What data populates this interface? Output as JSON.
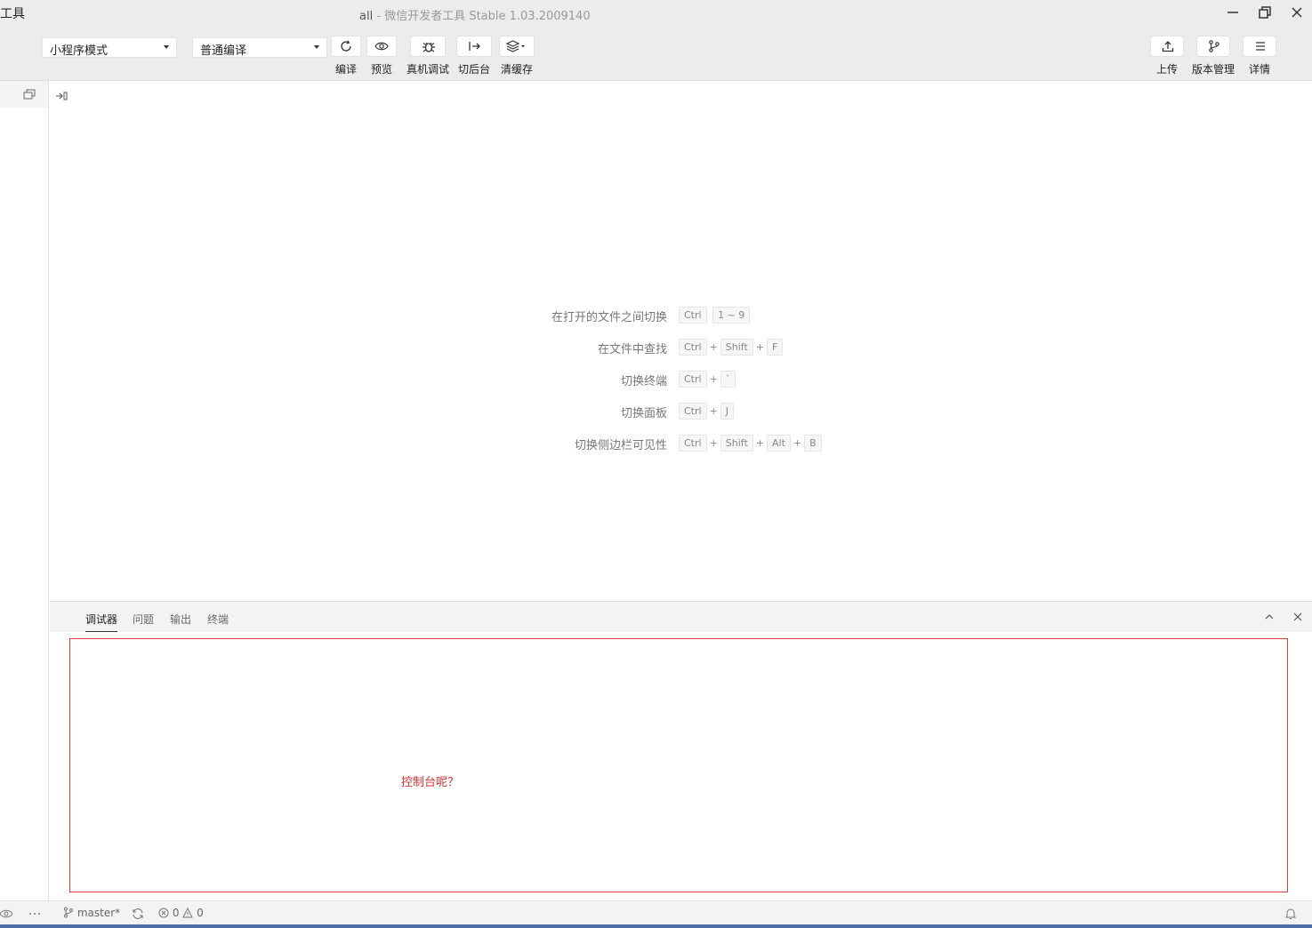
{
  "window": {
    "app_fragment": "工具",
    "project": "all",
    "separator": "-",
    "title": "微信开发者工具 Stable 1.03.2009140"
  },
  "toolbar": {
    "mode_select": "小程序模式",
    "compile_select": "普通编译",
    "tools": [
      {
        "label": "编译",
        "icon": "refresh-icon"
      },
      {
        "label": "预览",
        "icon": "eye-icon"
      },
      {
        "label": "真机调试",
        "icon": "bug-icon"
      },
      {
        "label": "切后台",
        "icon": "switch-background-icon"
      },
      {
        "label": "清缓存",
        "icon": "layers-icon"
      }
    ],
    "right_tools": [
      {
        "label": "上传",
        "icon": "upload-icon"
      },
      {
        "label": "版本管理",
        "icon": "git-branch-icon"
      },
      {
        "label": "详情",
        "icon": "menu-icon"
      }
    ]
  },
  "shortcuts": [
    {
      "label": "在打开的文件之间切换",
      "keys": [
        "Ctrl",
        "1 ~ 9"
      ],
      "joined": false
    },
    {
      "label": "在文件中查找",
      "keys": [
        "Ctrl",
        "Shift",
        "F"
      ],
      "joined": true
    },
    {
      "label": "切换终端",
      "keys": [
        "Ctrl",
        "`"
      ],
      "joined": true
    },
    {
      "label": "切换面板",
      "keys": [
        "Ctrl",
        "J"
      ],
      "joined": true
    },
    {
      "label": "切换侧边栏可见性",
      "keys": [
        "Ctrl",
        "Shift",
        "Alt",
        "B"
      ],
      "joined": true
    }
  ],
  "plus": "+",
  "panel": {
    "tabs": [
      "调试器",
      "问题",
      "输出",
      "终端"
    ],
    "active_tab": 0,
    "console_message": "控制台呢？"
  },
  "statusbar": {
    "branch": "master*",
    "errors": "0",
    "warnings": "0"
  },
  "colors": {
    "console_border": "#e23b3b",
    "console_message": "#d63131",
    "chrome_bg": "#ececec"
  }
}
